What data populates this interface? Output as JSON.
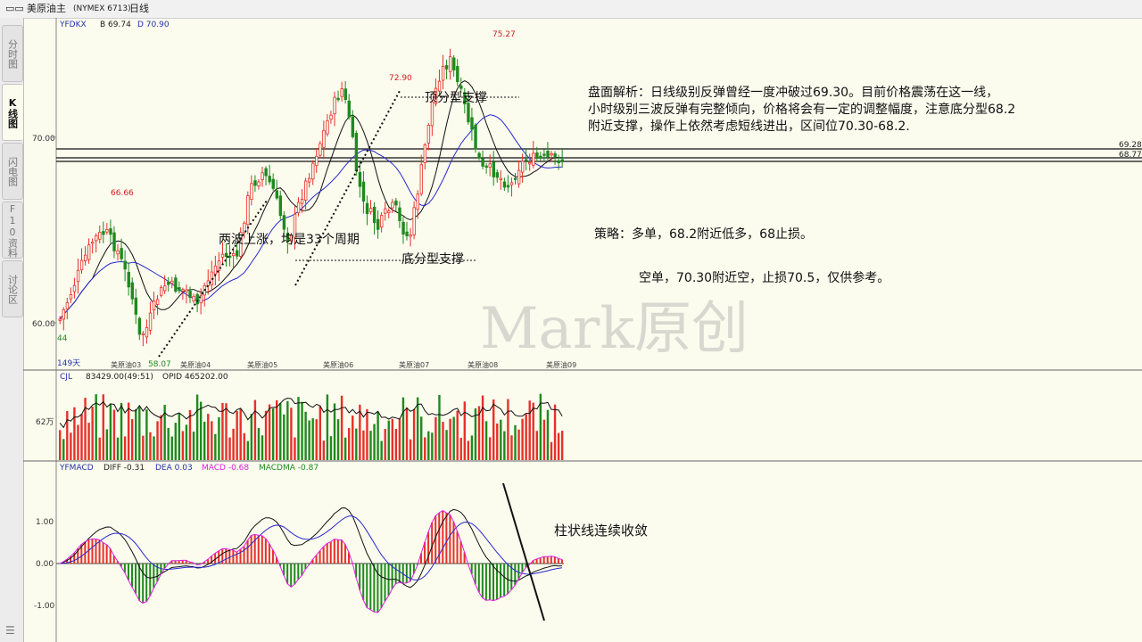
{
  "titlebar": {
    "menu_icon": "window-menu-icon",
    "symbol": "美原油主",
    "exchange": "(NYMEX 6713)",
    "period": "日线"
  },
  "side_tabs": [
    "分时图",
    "K线图",
    "闪电图",
    "F10资料",
    "讨论区"
  ],
  "main_panel": {
    "indicator": "YFDKX",
    "b_label": "B 69.74",
    "d_label": "D 70.90",
    "y_labels": [
      "70.00",
      "60.00"
    ],
    "right_labels": [
      "69.28",
      "68.77"
    ],
    "high_labels": [
      "66.66",
      "72.90",
      "75.27"
    ],
    "low_labels": [
      "58.07"
    ],
    "left_marker": "44",
    "days_label": "149天",
    "month_labels": [
      "美原油03",
      "美原油04",
      "美原油05",
      "美原油06",
      "美原油07",
      "美原油08",
      "美原油09"
    ]
  },
  "volume_panel": {
    "indicator": "CJL",
    "vol_text": "83429.00(49:51)",
    "opid_text": "OPID 465202.00",
    "y_label": "62万"
  },
  "macd_panel": {
    "indicator": "YFMACD",
    "diff": "DIFF -0.31",
    "dea": "DEA 0.03",
    "macd": "MACD -0.68",
    "macdma": "MACDMA -0.87",
    "y_labels": [
      "1.00",
      "0.00",
      "-1.00"
    ],
    "annotation": "柱状线连续收敛"
  },
  "annotations": {
    "top_fractal": "顶分型支撑",
    "bottom_fractal": "底分型支撑",
    "two_waves": "两波上涨，均是33个周期",
    "analysis": [
      "盘面解析：日线级别反弹曾经一度冲破过69.30。目前价格震荡在这一线，",
      "小时级别三波反弹有完整倾向，价格将会有一定的调整幅度，注意底分型68.2",
      "附近支撑，操作上依然考虑短线进出，区间位70.30-68.2."
    ],
    "strategy_long": "策略：多单，68.2附近低多，68止损。",
    "strategy_short": "空单，70.30附近空，止损70.5，仅供参考。",
    "watermark": "Mark原创"
  },
  "colors": {
    "up": "#e8302a",
    "down": "#1e8a1e",
    "ma_short": "#111111",
    "ma_long": "#2a2ad0",
    "macd_line": "#e020e0",
    "bg": "#fbfbee"
  }
}
